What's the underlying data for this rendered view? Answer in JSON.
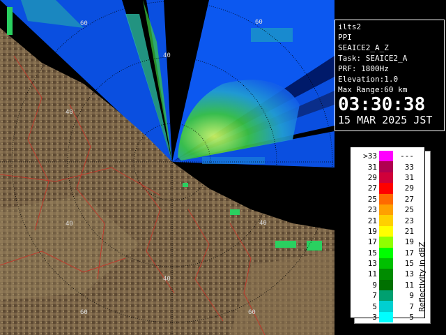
{
  "ring_labels": [
    "60",
    "40",
    "40",
    "60",
    "40",
    "40",
    "40",
    "60",
    "60"
  ],
  "info": {
    "site": "ilts2",
    "product": "PPI",
    "scan_name": "SEAICE2_A_Z",
    "task": "Task: SEAICE2_A",
    "prf": "PRF: 1800Hz",
    "elevation": "Elevation:1.0",
    "max_range": "Max Range:60 km",
    "time": "03:30:38",
    "date": "15 MAR 2025 JST"
  },
  "legend": {
    "title": "Reflectivity in dBZ",
    "rows": [
      {
        "left": ">33",
        "right": "---",
        "color": "#ff00ff"
      },
      {
        "left": "31",
        "right": "33",
        "color": "#b00050"
      },
      {
        "left": "29",
        "right": "31",
        "color": "#d0003a"
      },
      {
        "left": "27",
        "right": "29",
        "color": "#ff0000"
      },
      {
        "left": "25",
        "right": "27",
        "color": "#ff6a00"
      },
      {
        "left": "23",
        "right": "25",
        "color": "#ffa000"
      },
      {
        "left": "21",
        "right": "23",
        "color": "#ffd000"
      },
      {
        "left": "19",
        "right": "21",
        "color": "#ffff00"
      },
      {
        "left": "17",
        "right": "19",
        "color": "#90ff00"
      },
      {
        "left": "15",
        "right": "17",
        "color": "#00ff00"
      },
      {
        "left": "13",
        "right": "15",
        "color": "#00c000"
      },
      {
        "left": "11",
        "right": "13",
        "color": "#008c00"
      },
      {
        "left": "9",
        "right": "11",
        "color": "#007000"
      },
      {
        "left": "7",
        "right": "9",
        "color": "#00a070"
      },
      {
        "left": "5",
        "right": "7",
        "color": "#00d0d0"
      },
      {
        "left": "3",
        "right": "5",
        "color": "#00ffff"
      }
    ]
  },
  "colors": {
    "sea_background": "#0a4fe0",
    "land": "#7a6448",
    "land_dark": "#4c3a26",
    "rivers": "#c0392b",
    "range_rings": "#000000"
  }
}
